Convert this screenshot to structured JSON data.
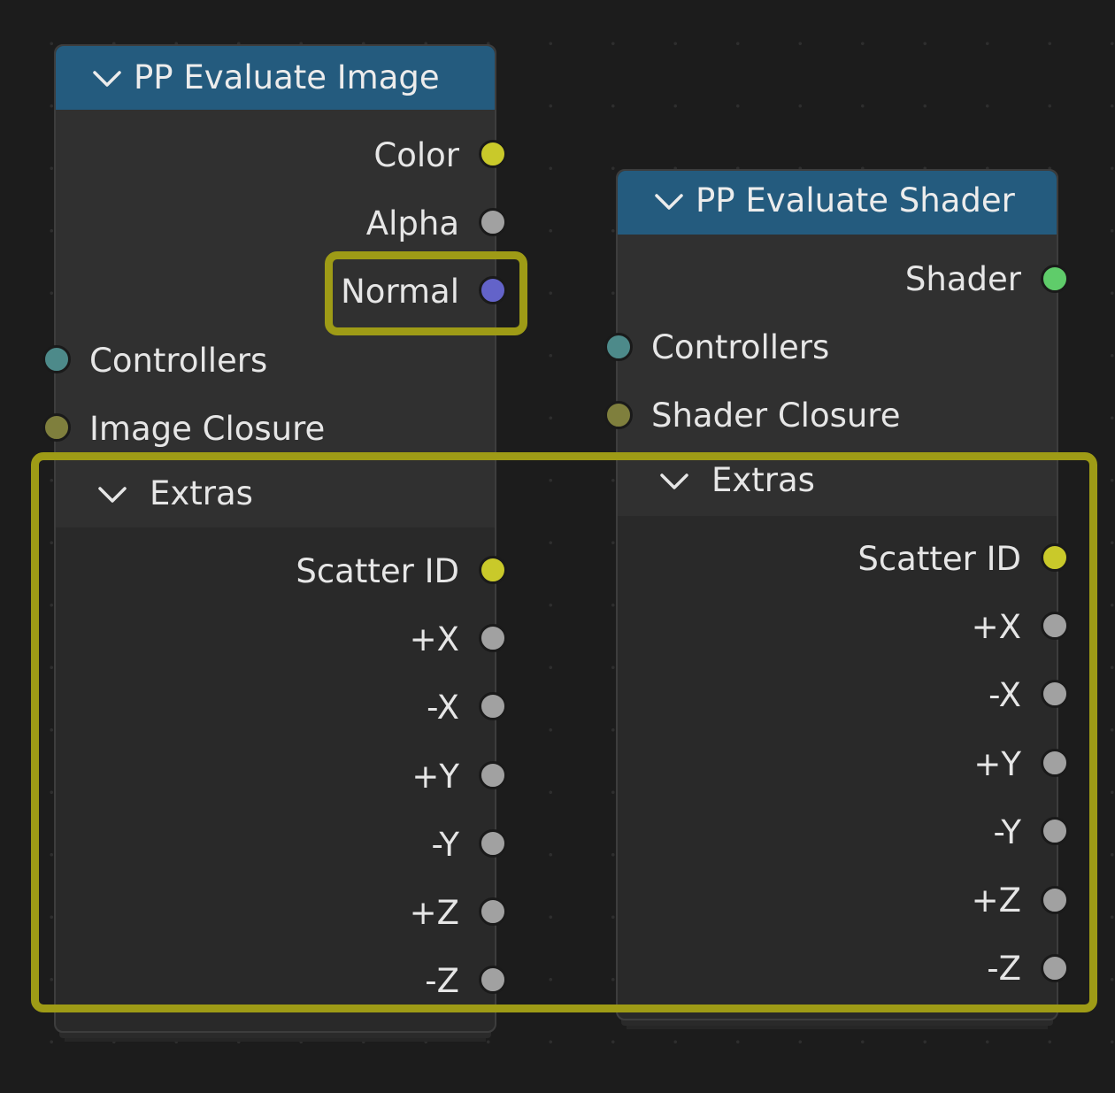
{
  "nodes": {
    "evaluate_image": {
      "title": "PP Evaluate Image",
      "outputs": [
        {
          "label": "Color",
          "color": "#c9c92a"
        },
        {
          "label": "Alpha",
          "color": "#a1a1a1"
        },
        {
          "label": "Normal",
          "color": "#6363c9"
        }
      ],
      "inputs": [
        {
          "label": "Controllers",
          "color": "#4d8a8a"
        },
        {
          "label": "Image Closure",
          "color": "#7f7f3d"
        }
      ],
      "panel": {
        "title": "Extras",
        "outputs": [
          {
            "label": "Scatter ID",
            "color": "#c9c92a"
          },
          {
            "label": "+X",
            "color": "#a1a1a1"
          },
          {
            "label": "-X",
            "color": "#a1a1a1"
          },
          {
            "label": "+Y",
            "color": "#a1a1a1"
          },
          {
            "label": "-Y",
            "color": "#a1a1a1"
          },
          {
            "label": "+Z",
            "color": "#a1a1a1"
          },
          {
            "label": "-Z",
            "color": "#a1a1a1"
          }
        ]
      }
    },
    "evaluate_shader": {
      "title": "PP Evaluate Shader",
      "outputs": [
        {
          "label": "Shader",
          "color": "#5fcc6a"
        }
      ],
      "inputs": [
        {
          "label": "Controllers",
          "color": "#4d8a8a"
        },
        {
          "label": "Shader Closure",
          "color": "#7f7f3d"
        }
      ],
      "panel": {
        "title": "Extras",
        "outputs": [
          {
            "label": "Scatter ID",
            "color": "#c9c92a"
          },
          {
            "label": "+X",
            "color": "#a1a1a1"
          },
          {
            "label": "-X",
            "color": "#a1a1a1"
          },
          {
            "label": "+Y",
            "color": "#a1a1a1"
          },
          {
            "label": "-Y",
            "color": "#a1a1a1"
          },
          {
            "label": "+Z",
            "color": "#a1a1a1"
          },
          {
            "label": "-Z",
            "color": "#a1a1a1"
          }
        ]
      }
    }
  },
  "colors": {
    "header": "#245b7e",
    "highlight": "#9e9b16",
    "background": "#1c1c1c"
  }
}
